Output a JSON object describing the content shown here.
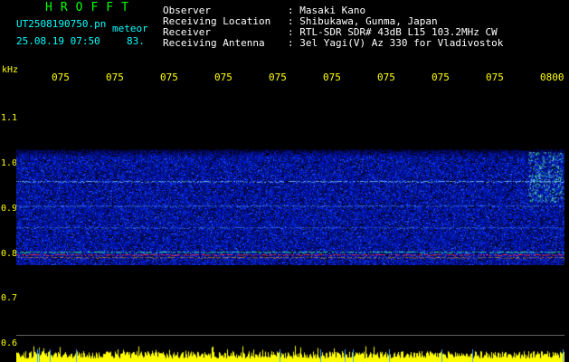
{
  "header": {
    "brand": "HROFFT",
    "filename": "UT2508190750.pn",
    "meteor_label": "meteor",
    "date_time": "25.08.19 07:50",
    "count": "83.",
    "info": [
      {
        "key": "Observer",
        "value": ": Masaki Kano"
      },
      {
        "key": "Receiving Location",
        "value": ": Shibukawa, Gunma, Japan"
      },
      {
        "key": "Receiver",
        "value": ": RTL-SDR SDR# 43dB L15 103.2MHz CW"
      },
      {
        "key": "Receiving Antenna",
        "value": ": 3el Yagi(V) Az 330 for Vladivostok"
      }
    ]
  },
  "axis": {
    "unit": "kHz",
    "time_labels": [
      "075",
      "075",
      "075",
      "075",
      "075",
      "075",
      "075",
      "075",
      "075",
      "0800"
    ],
    "freq_labels": [
      "1.1",
      "1.0",
      "0.9",
      "0.8",
      "0.7",
      "0.6"
    ]
  },
  "colors": {
    "header_brand": "#00ff00",
    "info_text": "#ffffff",
    "time_axis": "#ffff00",
    "spectrum_base": "#0a1a8c",
    "spectrum_bright": "#3c78ff",
    "trace_green": "#38ff90",
    "trace_red": "#ff3030",
    "signal_bar": "#ffff00"
  }
}
